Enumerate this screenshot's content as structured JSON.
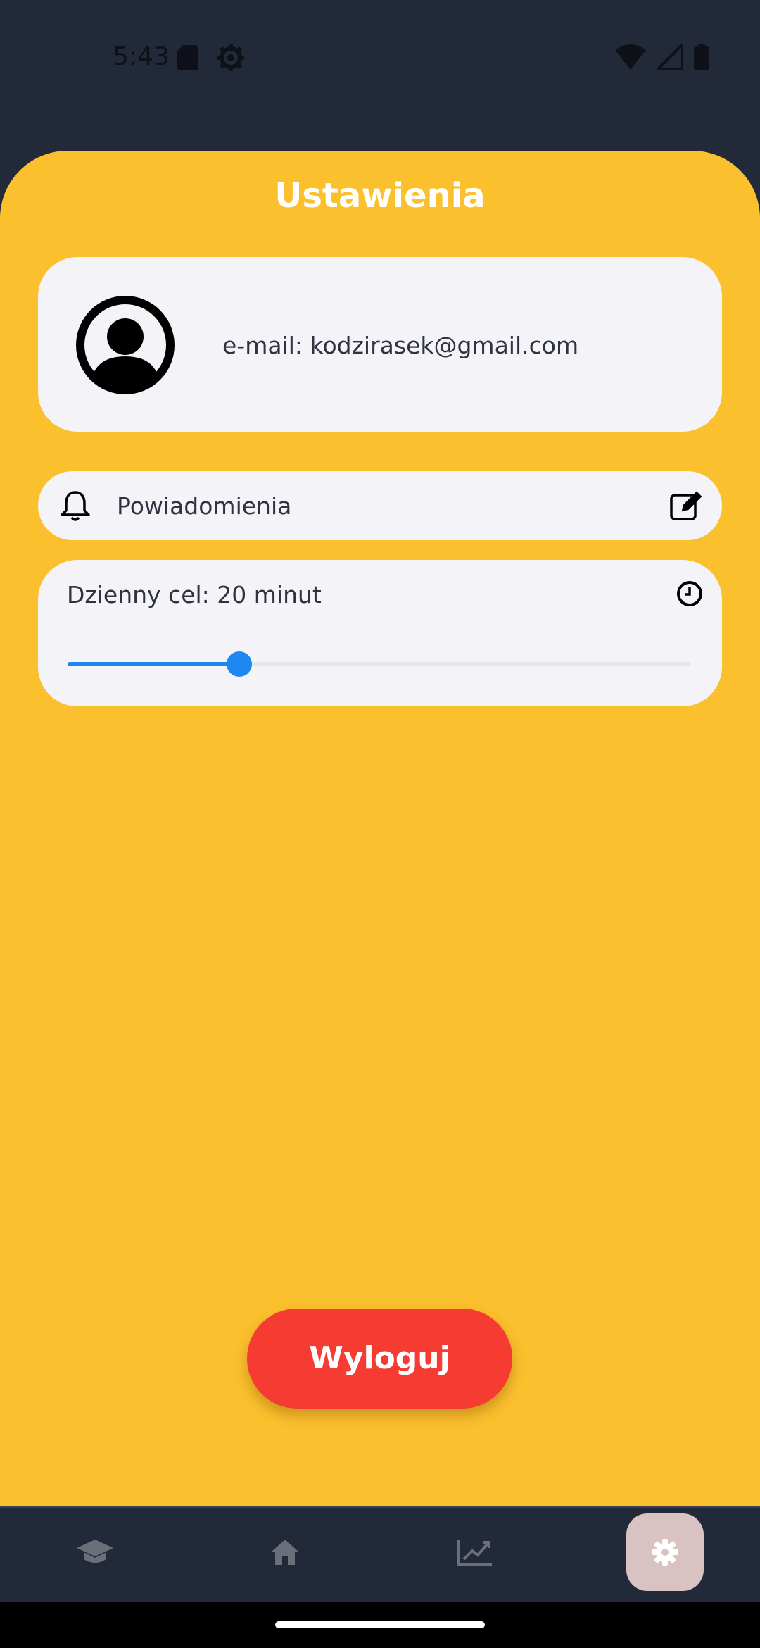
{
  "status_bar": {
    "time": "5:43",
    "left_icons": [
      "sd-card-icon",
      "settings-gear-icon"
    ],
    "right_icons": [
      "wifi-icon",
      "cell-signal-icon",
      "battery-icon"
    ]
  },
  "header": {
    "title": "Ustawienia"
  },
  "profile": {
    "avatar_icon": "user-avatar-icon",
    "email_text": "e-mail: kodzirasek@gmail.com"
  },
  "notifications": {
    "label": "Powiadomienia",
    "leading_icon": "bell-icon",
    "trailing_icon": "edit-icon"
  },
  "daily_goal": {
    "label": "Dzienny cel: 20 minut",
    "icon": "clock-icon",
    "slider_fraction": 0.275
  },
  "logout": {
    "label": "Wyloguj"
  },
  "bottom_nav": {
    "items": [
      {
        "icon": "graduation-cap-icon",
        "active": false
      },
      {
        "icon": "home-icon",
        "active": false
      },
      {
        "icon": "chart-line-icon",
        "active": false
      },
      {
        "icon": "settings-gear-icon",
        "active": true
      }
    ]
  },
  "colors": {
    "background_panel": "#FBC02D",
    "card": "#F4F3F8",
    "accent_blue": "#1E88F0",
    "logout_red": "#F63C32",
    "nav_bg": "#222938"
  }
}
